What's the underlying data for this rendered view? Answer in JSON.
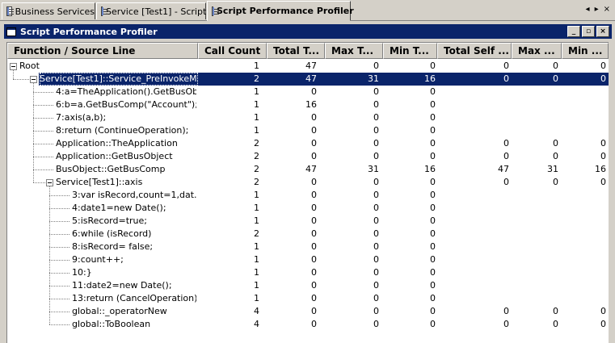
{
  "tabs": [
    {
      "label": "Business Services",
      "icon": "list-icon",
      "active": false
    },
    {
      "label": "Service [Test1] - Script",
      "icon": "list-icon",
      "active": false
    },
    {
      "label": "Script Performance Profiler",
      "icon": "list-icon",
      "active": true
    }
  ],
  "nav": {
    "left": "◂",
    "right": "▸",
    "close": "×"
  },
  "panel": {
    "title": "Script Performance Profiler",
    "buttons": {
      "minimize": "_",
      "restore": "▫",
      "close": "×"
    }
  },
  "columns": [
    "Function / Source Line",
    "Call Count",
    "Total T...",
    "Max T...",
    "Min T...",
    "Total Self ...",
    "Max ...",
    "Min ..."
  ],
  "rows": [
    {
      "name": "Root",
      "level": 0,
      "expandable": true,
      "values": [
        "1",
        "47",
        "0",
        "0",
        "0",
        "0",
        "0"
      ]
    },
    {
      "name": "Service[Test1]::Service_PreInvokeM...",
      "level": 1,
      "expandable": true,
      "selected": true,
      "values": [
        "2",
        "47",
        "31",
        "16",
        "0",
        "0",
        "0"
      ]
    },
    {
      "name": "4:a=TheApplication().GetBusObj...",
      "level": 2,
      "values": [
        "1",
        "0",
        "0",
        "0",
        "",
        "",
        ""
      ]
    },
    {
      "name": "6:b=a.GetBusComp(\"Account\");",
      "level": 2,
      "values": [
        "1",
        "16",
        "0",
        "0",
        "",
        "",
        ""
      ]
    },
    {
      "name": "7:axis(a,b);",
      "level": 2,
      "values": [
        "1",
        "0",
        "0",
        "0",
        "",
        "",
        ""
      ]
    },
    {
      "name": "8:return (ContinueOperation);",
      "level": 2,
      "values": [
        "1",
        "0",
        "0",
        "0",
        "",
        "",
        ""
      ]
    },
    {
      "name": "Application::TheApplication",
      "level": 2,
      "values": [
        "2",
        "0",
        "0",
        "0",
        "0",
        "0",
        "0"
      ]
    },
    {
      "name": "Application::GetBusObject",
      "level": 2,
      "values": [
        "2",
        "0",
        "0",
        "0",
        "0",
        "0",
        "0"
      ]
    },
    {
      "name": "BusObject::GetBusComp",
      "level": 2,
      "values": [
        "2",
        "47",
        "31",
        "16",
        "47",
        "31",
        "16"
      ]
    },
    {
      "name": "Service[Test1]::axis",
      "level": 2,
      "expandable": true,
      "values": [
        "2",
        "0",
        "0",
        "0",
        "0",
        "0",
        "0"
      ]
    },
    {
      "name": "3:var isRecord,count=1,dat...",
      "level": 3,
      "values": [
        "1",
        "0",
        "0",
        "0",
        "",
        "",
        ""
      ]
    },
    {
      "name": "4:date1=new Date();",
      "level": 3,
      "values": [
        "1",
        "0",
        "0",
        "0",
        "",
        "",
        ""
      ]
    },
    {
      "name": "5:isRecord=true;",
      "level": 3,
      "values": [
        "1",
        "0",
        "0",
        "0",
        "",
        "",
        ""
      ]
    },
    {
      "name": "6:while (isRecord)",
      "level": 3,
      "values": [
        "2",
        "0",
        "0",
        "0",
        "",
        "",
        ""
      ]
    },
    {
      "name": "8:isRecord= false;",
      "level": 3,
      "values": [
        "1",
        "0",
        "0",
        "0",
        "",
        "",
        ""
      ]
    },
    {
      "name": "9:count++;",
      "level": 3,
      "values": [
        "1",
        "0",
        "0",
        "0",
        "",
        "",
        ""
      ]
    },
    {
      "name": "10:}",
      "level": 3,
      "values": [
        "1",
        "0",
        "0",
        "0",
        "",
        "",
        ""
      ]
    },
    {
      "name": "11:date2=new Date();",
      "level": 3,
      "values": [
        "1",
        "0",
        "0",
        "0",
        "",
        "",
        ""
      ]
    },
    {
      "name": "13:return (CancelOperation);",
      "level": 3,
      "values": [
        "1",
        "0",
        "0",
        "0",
        "",
        "",
        ""
      ]
    },
    {
      "name": "global::_operatorNew",
      "level": 3,
      "values": [
        "4",
        "0",
        "0",
        "0",
        "0",
        "0",
        "0"
      ]
    },
    {
      "name": "global::ToBoolean",
      "level": 3,
      "values": [
        "4",
        "0",
        "0",
        "0",
        "0",
        "0",
        "0"
      ]
    }
  ],
  "colors": {
    "selection": "#0a246a",
    "titlebar": "#0a246a",
    "chrome": "#d4d0c8"
  }
}
